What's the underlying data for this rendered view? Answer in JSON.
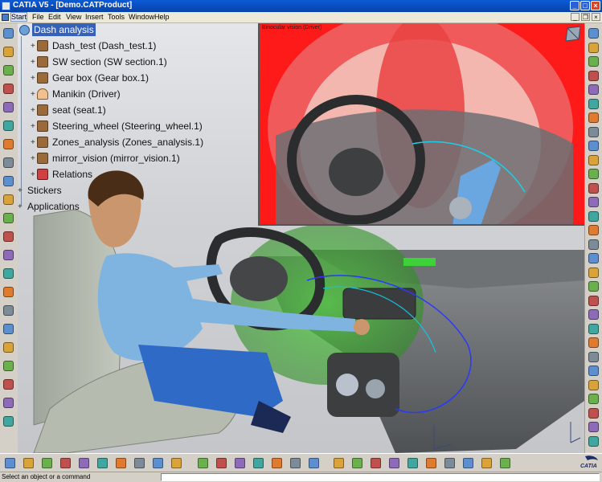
{
  "window": {
    "title": "CATIA V5 - [Demo.CATProduct]"
  },
  "menu": [
    "Start",
    "File",
    "Edit",
    "View",
    "Insert",
    "Tools",
    "Window",
    "Help"
  ],
  "tree": {
    "root": "Dash analysis",
    "nodes": [
      "Dash_test (Dash_test.1)",
      "SW section (SW section.1)",
      "Gear box (Gear box.1)",
      "Manikin (Driver)",
      "seat (seat.1)",
      "Steering_wheel (Steering_wheel.1)",
      "Zones_analysis (Zones_analysis.1)",
      "mirror_vision (mirror_vision.1)",
      "Relations",
      "Stickers",
      "Applications"
    ]
  },
  "ocular_view": {
    "title": "Binocular vision (Driver)"
  },
  "logo_text": "CATIA",
  "status": {
    "text": "Select an object or a command"
  },
  "colors": {
    "titlebar": "#0a5bd6",
    "tree_selection": "#3561b8",
    "vision_field": "#ff1a1a",
    "shirt": "#7fb3e0"
  },
  "icons": {
    "left_toolbar": [
      "product-icon",
      "move-icon",
      "snap-icon",
      "explode-icon",
      "clash-icon",
      "section-icon",
      "distance-icon",
      "measure-icon",
      "annotation-icon",
      "manikin-icon",
      "posture-icon",
      "vision-icon",
      "reach-icon",
      "ergonomics-icon",
      "catalog-icon",
      "constraint-icon",
      "fix-icon",
      "contact-icon",
      "coincidence-icon",
      "offset-icon",
      "angle-icon",
      "update-icon"
    ],
    "right_toolbar": [
      "manikin-insert-icon",
      "forward-kinematics-icon",
      "inverse-kinematics-icon",
      "vision-window-icon",
      "reach-envelope-icon",
      "posture-editor-icon",
      "angular-limits-icon",
      "preferred-angles-icon",
      "lock-icon",
      "swap-icon",
      "reset-posture-icon",
      "standard-pose-icon",
      "sit-pose-icon",
      "walk-icon",
      "rula-icon",
      "lift-icon",
      "push-pull-icon",
      "carry-icon",
      "biomechanics-icon",
      "measure-body-icon",
      "anthropometry-icon",
      "optimize-icon",
      "manikin-attach-icon",
      "hand-icon",
      "foot-icon",
      "head-icon",
      "spine-icon",
      "clash-detect-icon",
      "report-icon",
      "settings-icon"
    ],
    "bottom_toolbar": [
      "new-icon",
      "open-icon",
      "save-icon",
      "print-icon",
      "cut-icon",
      "copy-icon",
      "paste-icon",
      "undo-icon",
      "redo-icon",
      "whats-this-icon",
      "formula-icon",
      "knowledge-icon",
      "catalog-icon",
      "tree-icon",
      "measure-icon",
      "graph-icon",
      "fly-icon",
      "pan-icon",
      "rotate-icon",
      "zoom-in-icon",
      "zoom-out-icon",
      "normal-view-icon",
      "views-icon",
      "render-style-icon",
      "hide-show-icon",
      "swap-space-icon",
      "layer-icon"
    ]
  }
}
